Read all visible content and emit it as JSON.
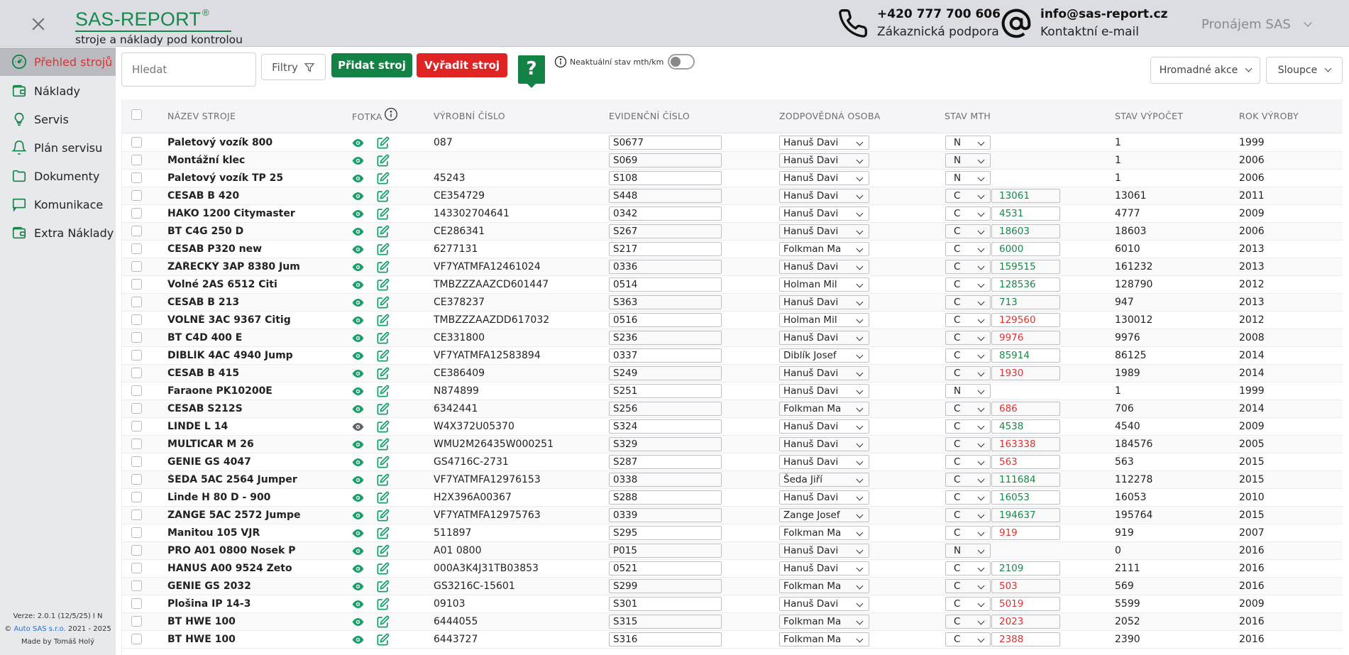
{
  "header": {
    "brand": "SAS-REPORT",
    "brand_mark": "®",
    "tagline": "stroje a náklady pod kontrolou",
    "phone": "+420 777 700 606",
    "phone_label": "Zákaznická podpora",
    "email": "info@sas-report.cz",
    "email_label": "Kontaktní e-mail",
    "account": "Pronájem SAS"
  },
  "sidebar": {
    "items": [
      {
        "label": "Přehled strojů",
        "icon": "dashboard-icon"
      },
      {
        "label": "Náklady",
        "icon": "wallet-icon"
      },
      {
        "label": "Servis",
        "icon": "lightbulb-icon"
      },
      {
        "label": "Plán servisu",
        "icon": "bell-icon"
      },
      {
        "label": "Dokumenty",
        "icon": "folder-icon"
      },
      {
        "label": "Komunikace",
        "icon": "chat-icon"
      },
      {
        "label": "Extra Náklady",
        "icon": "wallet-icon"
      }
    ],
    "version": "Verze: 2.0.1 (12/5/25) I N",
    "copyright_prefix": "©",
    "company": "Auto SAS s.r.o.",
    "years": "2021 - 2025",
    "made_by": "Made by Tomáš Holý"
  },
  "toolbar": {
    "search_placeholder": "Hledat",
    "filter_label": "Filtry",
    "add_label": "Přidat stroj",
    "retire_label": "Vyřadit stroj",
    "help_label": "?",
    "stale_label": "Neaktuální stav mth/km",
    "bulk_label": "Hromadné akce",
    "columns_label": "Sloupce"
  },
  "table": {
    "headers": {
      "name": "NÁZEV STROJE",
      "photo": "FOTKA",
      "serial": "VÝROBNÍ ČÍSLO",
      "evid": "EVIDENČNÍ ČÍSLO",
      "person": "ZODPOVĚDNÁ OSOBA",
      "mth": "STAV MTH",
      "calc": "STAV VÝPOČET",
      "year": "ROK VÝROBY"
    },
    "rows": [
      {
        "name": "Paletový vozík 800",
        "serial": "087",
        "evid": "S0677",
        "person": "Hanuš Davi",
        "mth_type": "N",
        "mth": "",
        "mth_status": "",
        "calc": "1",
        "year": "1999"
      },
      {
        "name": "Montážní klec",
        "serial": "",
        "evid": "S069",
        "person": "Hanuš Davi",
        "mth_type": "N",
        "mth": "",
        "mth_status": "",
        "calc": "1",
        "year": "2006"
      },
      {
        "name": "Paletový vozík TP 25",
        "serial": "45243",
        "evid": "S108",
        "person": "Hanuš Davi",
        "mth_type": "N",
        "mth": "",
        "mth_status": "",
        "calc": "1",
        "year": "2006"
      },
      {
        "name": "CESAB B 420",
        "serial": "CE354729",
        "evid": "S448",
        "person": "Hanuš Davi",
        "mth_type": "C",
        "mth": "13061",
        "mth_status": "ok",
        "calc": "13061",
        "year": "2011"
      },
      {
        "name": "HAKO 1200 Citymaster",
        "serial": "143302704641",
        "evid": "0342",
        "person": "Hanuš Davi",
        "mth_type": "C",
        "mth": "4531",
        "mth_status": "ok",
        "calc": "4777",
        "year": "2009"
      },
      {
        "name": "BT C4G 250 D",
        "serial": "CE286341",
        "evid": "S267",
        "person": "Hanuš Davi",
        "mth_type": "C",
        "mth": "18603",
        "mth_status": "ok",
        "calc": "18603",
        "year": "2006"
      },
      {
        "name": "CESAB P320 new",
        "serial": "6277131",
        "evid": "S217",
        "person": "Folkman Ma",
        "mth_type": "C",
        "mth": "6000",
        "mth_status": "ok",
        "calc": "6010",
        "year": "2013"
      },
      {
        "name": "ZÁŘECKÝ 3AP 8380 Jum",
        "serial": "VF7YATMFA12461024",
        "evid": "0336",
        "person": "Hanuš Davi",
        "mth_type": "C",
        "mth": "159515",
        "mth_status": "ok",
        "calc": "161232",
        "year": "2013"
      },
      {
        "name": "Volné 2AS 6512 Citi",
        "serial": "TMBZZZAAZCD601447",
        "evid": "0514",
        "person": "Holman Mil",
        "mth_type": "C",
        "mth": "128536",
        "mth_status": "ok",
        "calc": "128790",
        "year": "2012"
      },
      {
        "name": "CESAB B 213",
        "serial": "CE378237",
        "evid": "S363",
        "person": "Hanuš Davi",
        "mth_type": "C",
        "mth": "713",
        "mth_status": "ok",
        "calc": "947",
        "year": "2013"
      },
      {
        "name": "VOLNÉ 3AC 9367 Citig",
        "serial": "TMBZZZAAZDD617032",
        "evid": "0516",
        "person": "Holman Mil",
        "mth_type": "C",
        "mth": "129560",
        "mth_status": "bad",
        "calc": "130012",
        "year": "2012"
      },
      {
        "name": "BT C4D 400 E",
        "serial": "CE331800",
        "evid": "S236",
        "person": "Hanuš Davi",
        "mth_type": "C",
        "mth": "9976",
        "mth_status": "bad",
        "calc": "9976",
        "year": "2008"
      },
      {
        "name": "DIBLÍK 4AC 4940 Jump",
        "serial": "VF7YATMFA12583894",
        "evid": "0337",
        "person": "Diblík Josef",
        "mth_type": "C",
        "mth": "85914",
        "mth_status": "ok",
        "calc": "86125",
        "year": "2014"
      },
      {
        "name": "CESAB B 415",
        "serial": "CE386409",
        "evid": "S249",
        "person": "Hanuš Davi",
        "mth_type": "C",
        "mth": "1930",
        "mth_status": "bad",
        "calc": "1989",
        "year": "2014"
      },
      {
        "name": "Faraone PK10200E",
        "serial": "N874899",
        "evid": "S251",
        "person": "Hanuš Davi",
        "mth_type": "N",
        "mth": "",
        "mth_status": "",
        "calc": "1",
        "year": "1999"
      },
      {
        "name": "CESAB S212S",
        "serial": "6342441",
        "evid": "S256",
        "person": "Folkman Ma",
        "mth_type": "C",
        "mth": "686",
        "mth_status": "bad",
        "calc": "706",
        "year": "2014"
      },
      {
        "name": "LINDE L 14",
        "serial": "W4X372U05370",
        "evid": "S324",
        "person": "Hanuš Davi",
        "mth_type": "C",
        "mth": "4538",
        "mth_status": "ok",
        "calc": "4540",
        "year": "2009",
        "eye": "gray"
      },
      {
        "name": "MULTICAR M 26",
        "serial": "WMU2M26435W000251",
        "evid": "S329",
        "person": "Hanuš Davi",
        "mth_type": "C",
        "mth": "163338",
        "mth_status": "bad",
        "calc": "184576",
        "year": "2005"
      },
      {
        "name": "GENIE GS 4047",
        "serial": "GS4716C-2731",
        "evid": "S287",
        "person": "Hanuš Davi",
        "mth_type": "C",
        "mth": "563",
        "mth_status": "bad",
        "calc": "563",
        "year": "2015"
      },
      {
        "name": "ŠEDA 5AC 2564 Jumper",
        "serial": "VF7YATMFA12976153",
        "evid": "0338",
        "person": "Šeda Jiří",
        "mth_type": "C",
        "mth": "111684",
        "mth_status": "ok",
        "calc": "112278",
        "year": "2015"
      },
      {
        "name": "Linde H 80 D - 900",
        "serial": "H2X396A00367",
        "evid": "S288",
        "person": "Hanuš Davi",
        "mth_type": "C",
        "mth": "16053",
        "mth_status": "ok",
        "calc": "16053",
        "year": "2010"
      },
      {
        "name": "ZANGE 5AC 2572 Jumpe",
        "serial": "VF7YATMFA12975763",
        "evid": "0339",
        "person": "Zange Josef",
        "mth_type": "C",
        "mth": "194637",
        "mth_status": "ok",
        "calc": "195764",
        "year": "2015"
      },
      {
        "name": "Manitou 105 VJR",
        "serial": "511897",
        "evid": "S295",
        "person": "Folkman Ma",
        "mth_type": "C",
        "mth": "919",
        "mth_status": "bad",
        "calc": "919",
        "year": "2007"
      },
      {
        "name": "PRO A01 0800 Nosek P",
        "serial": "A01 0800",
        "evid": "P015",
        "person": "Hanuš Davi",
        "mth_type": "N",
        "mth": "",
        "mth_status": "",
        "calc": "0",
        "year": "2016"
      },
      {
        "name": "HANUŠ A00 9524 Zeto",
        "serial": "000A3K4J31TB03853",
        "evid": "0521",
        "person": "Hanuš Davi",
        "mth_type": "C",
        "mth": "2109",
        "mth_status": "ok",
        "calc": "2111",
        "year": "2016"
      },
      {
        "name": "GENIE GS 2032",
        "serial": "GS3216C-15601",
        "evid": "S299",
        "person": "Folkman Ma",
        "mth_type": "C",
        "mth": "503",
        "mth_status": "bad",
        "calc": "569",
        "year": "2016"
      },
      {
        "name": "Plošina IP 14-3",
        "serial": "09103",
        "evid": "S301",
        "person": "Hanuš Davi",
        "mth_type": "C",
        "mth": "5019",
        "mth_status": "bad",
        "calc": "5599",
        "year": "2009"
      },
      {
        "name": "BT HWE 100",
        "serial": "6444055",
        "evid": "S315",
        "person": "Folkman Ma",
        "mth_type": "C",
        "mth": "2023",
        "mth_status": "bad",
        "calc": "2052",
        "year": "2016"
      },
      {
        "name": "BT HWE 100",
        "serial": "6443727",
        "evid": "S316",
        "person": "Folkman Ma",
        "mth_type": "C",
        "mth": "2388",
        "mth_status": "bad",
        "calc": "2390",
        "year": "2016"
      }
    ]
  },
  "colors": {
    "brand_green": "#16894a",
    "add_button": "#128345",
    "retire_button": "#e02424",
    "active_nav_text": "#e03131",
    "mth_ok": "#16894a",
    "mth_bad": "#e03131"
  }
}
